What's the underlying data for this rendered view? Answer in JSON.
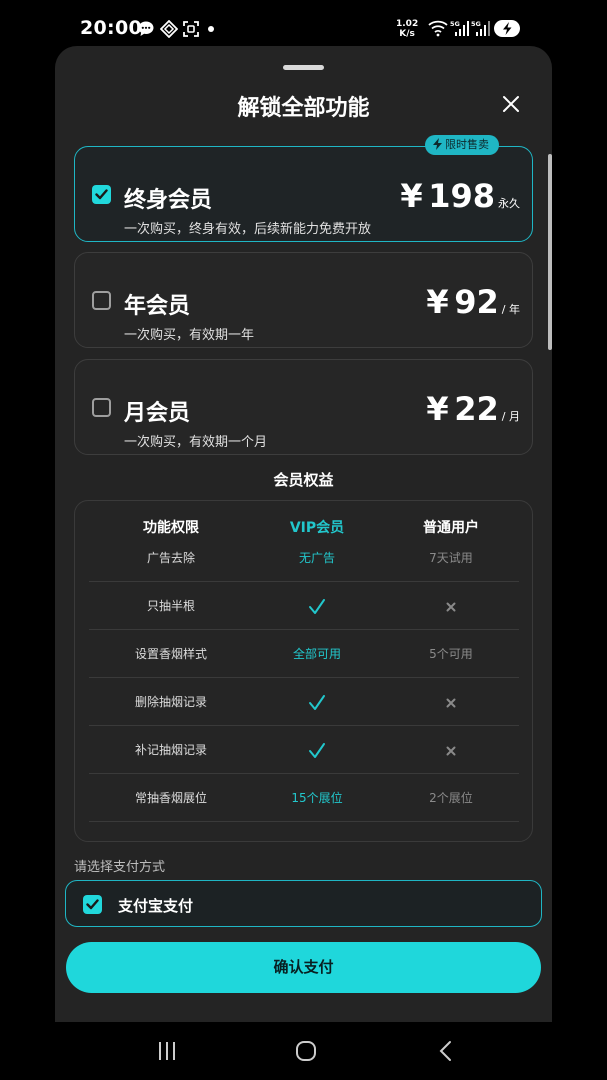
{
  "status_bar": {
    "time": "20:00",
    "speed_value": "1.02",
    "speed_unit": "K/s",
    "icons": [
      "chat-icon",
      "vpn-icon",
      "screenshot-icon",
      "wifi-icon",
      "signal-5g-icon",
      "signal-5g-icon",
      "battery-charging-icon"
    ]
  },
  "sheet": {
    "title": "解锁全部功能",
    "plans": [
      {
        "name": "终身会员",
        "desc": "一次购买，终身有效，后续新能力免费开放",
        "currency": "¥",
        "price": "198",
        "unit": "永久",
        "selected": true,
        "badge": "限时售卖"
      },
      {
        "name": "年会员",
        "desc": "一次购买，有效期一年",
        "currency": "¥",
        "price": "92",
        "unit": "/ 年",
        "selected": false
      },
      {
        "name": "月会员",
        "desc": "一次购买，有效期一个月",
        "currency": "¥",
        "price": "22",
        "unit": "/ 月",
        "selected": false
      }
    ],
    "benefits": {
      "title": "会员权益",
      "headers": [
        "功能权限",
        "VIP会员",
        "普通用户"
      ],
      "rows": [
        {
          "feature": "广告去除",
          "vip": "无广告",
          "normal": "7天试用"
        },
        {
          "feature": "只抽半根",
          "vip": "check",
          "normal": "cross"
        },
        {
          "feature": "设置香烟样式",
          "vip": "全部可用",
          "normal": "5个可用"
        },
        {
          "feature": "删除抽烟记录",
          "vip": "check",
          "normal": "cross"
        },
        {
          "feature": "补记抽烟记录",
          "vip": "check",
          "normal": "cross"
        },
        {
          "feature": "常抽香烟展位",
          "vip": "15个展位",
          "normal": "2个展位"
        }
      ]
    },
    "payment": {
      "label": "请选择支付方式",
      "method": "支付宝支付",
      "selected": true,
      "confirm": "确认支付"
    }
  },
  "colors": {
    "accent": "#1fd7db",
    "sheet_bg": "#242424",
    "vip_text": "#22c7cc"
  }
}
